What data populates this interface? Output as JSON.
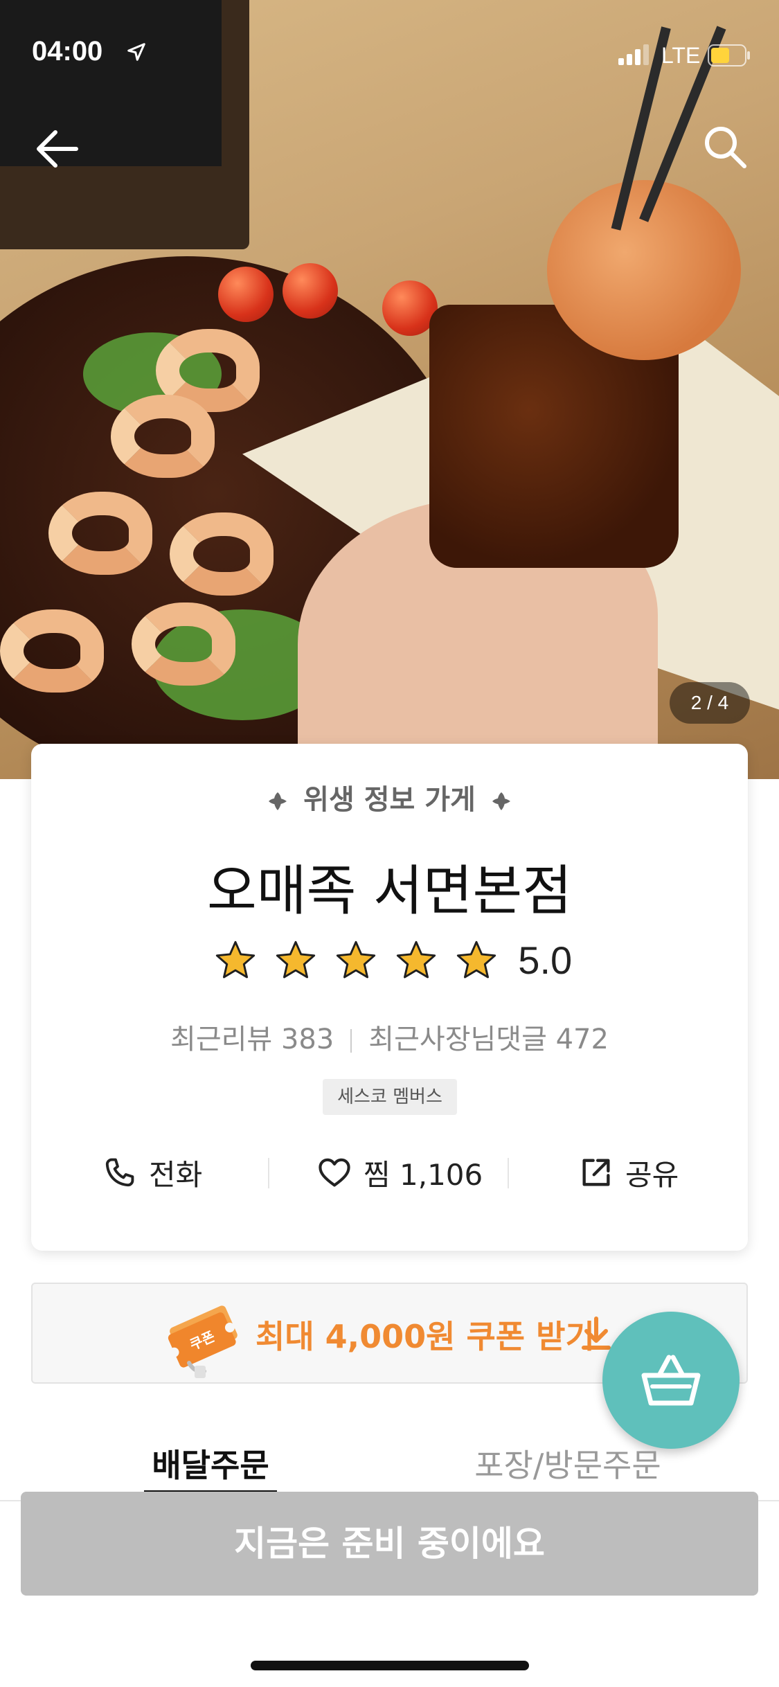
{
  "status_bar": {
    "time": "04:00",
    "network": "LTE"
  },
  "hero": {
    "page_indicator": "2 / 4"
  },
  "store": {
    "hygiene_label": "위생 정보 가게",
    "name": "오매족 서면본점",
    "rating": "5.0",
    "stars": 5,
    "recent_reviews": "최근리뷰 383",
    "recent_owner_replies": "최근사장님댓글 472",
    "badge": "세스코 멤버스"
  },
  "actions": {
    "call_label": "전화",
    "favorite_label": "찜 1,106",
    "share_label": "공유"
  },
  "coupon": {
    "icon_text": "쿠폰",
    "label": "최대 4,000원 쿠폰 받기"
  },
  "tabs": [
    {
      "label": "배달주문",
      "active": true
    },
    {
      "label": "포장/방문주문",
      "active": false
    }
  ],
  "order_button": {
    "label": "지금은 준비 중이에요"
  },
  "colors": {
    "accent_orange": "#f08a32",
    "cart_teal": "#5fc0bb",
    "star_gold": "#f5b82e",
    "disabled_button": "#bdbdbd"
  }
}
